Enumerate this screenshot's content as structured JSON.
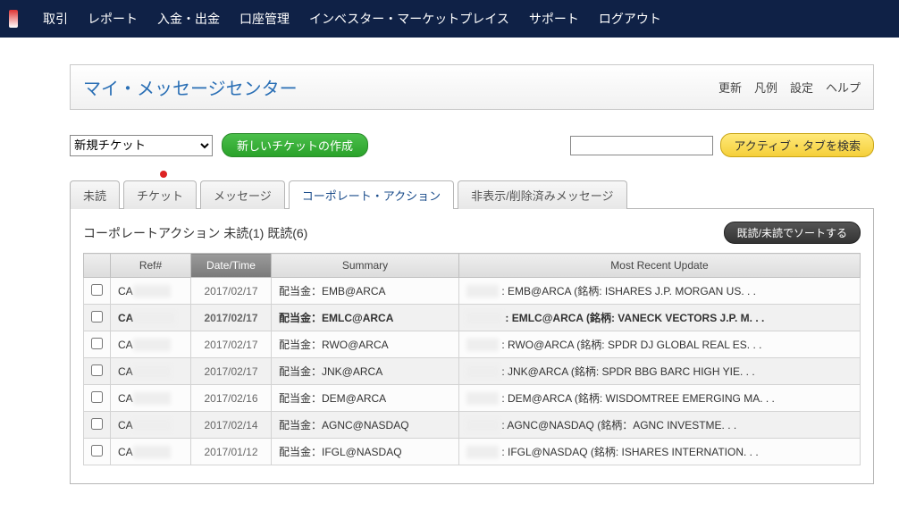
{
  "nav": {
    "items": [
      "取引",
      "レポート",
      "入金・出金",
      "口座管理",
      "インベスター・マーケットプレイス",
      "サポート",
      "ログアウト"
    ]
  },
  "header": {
    "title": "マイ・メッセージセンター",
    "links": [
      "更新",
      "凡例",
      "設定",
      "ヘルプ"
    ]
  },
  "controls": {
    "ticket_select_value": "新規チケット",
    "create_ticket_label": "新しいチケットの作成",
    "search_button_label": "アクティブ・タブを検索"
  },
  "tabs": {
    "items": [
      {
        "label": "未読",
        "active": false,
        "dot": false
      },
      {
        "label": "チケット",
        "active": false,
        "dot": true
      },
      {
        "label": "メッセージ",
        "active": false,
        "dot": false
      },
      {
        "label": "コーポレート・アクション",
        "active": true,
        "dot": false
      },
      {
        "label": "非表示/削除済みメッセージ",
        "active": false,
        "dot": false
      }
    ]
  },
  "subheader": {
    "text": "コーポレートアクション 未読(1) 既読(6)",
    "sort_button": "既読/未読でソートする"
  },
  "table": {
    "columns": {
      "chk": "",
      "ref": "Ref#",
      "date": "Date/Time",
      "summary": "Summary",
      "update": "Most Recent Update"
    },
    "rows": [
      {
        "unread": false,
        "ref_prefix": "CA",
        "date": "2017/02/17",
        "summary": "配当金：EMB@ARCA",
        "update": ": EMB@ARCA (銘柄: ISHARES J.P. MORGAN US. . ."
      },
      {
        "unread": true,
        "ref_prefix": "CA",
        "date": "2017/02/17",
        "summary": "配当金：EMLC@ARCA",
        "update": ": EMLC@ARCA (銘柄: VANECK VECTORS J.P. M. . ."
      },
      {
        "unread": false,
        "ref_prefix": "CA",
        "date": "2017/02/17",
        "summary": "配当金：RWO@ARCA",
        "update": ": RWO@ARCA (銘柄: SPDR DJ GLOBAL REAL ES. . ."
      },
      {
        "unread": false,
        "ref_prefix": "CA",
        "date": "2017/02/17",
        "summary": "配当金：JNK@ARCA",
        "update": ": JNK@ARCA (銘柄: SPDR BBG BARC HIGH YIE. . ."
      },
      {
        "unread": false,
        "ref_prefix": "CA",
        "date": "2017/02/16",
        "summary": "配当金：DEM@ARCA",
        "update": ": DEM@ARCA (銘柄: WISDOMTREE EMERGING MA. . ."
      },
      {
        "unread": false,
        "ref_prefix": "CA",
        "date": "2017/02/14",
        "summary": "配当金：AGNC@NASDAQ",
        "update": ": AGNC@NASDAQ (銘柄：AGNC INVESTME. . ."
      },
      {
        "unread": false,
        "ref_prefix": "CA",
        "date": "2017/01/12",
        "summary": "配当金：IFGL@NASDAQ",
        "update": ": IFGL@NASDAQ (銘柄: ISHARES INTERNATION. . ."
      }
    ]
  }
}
